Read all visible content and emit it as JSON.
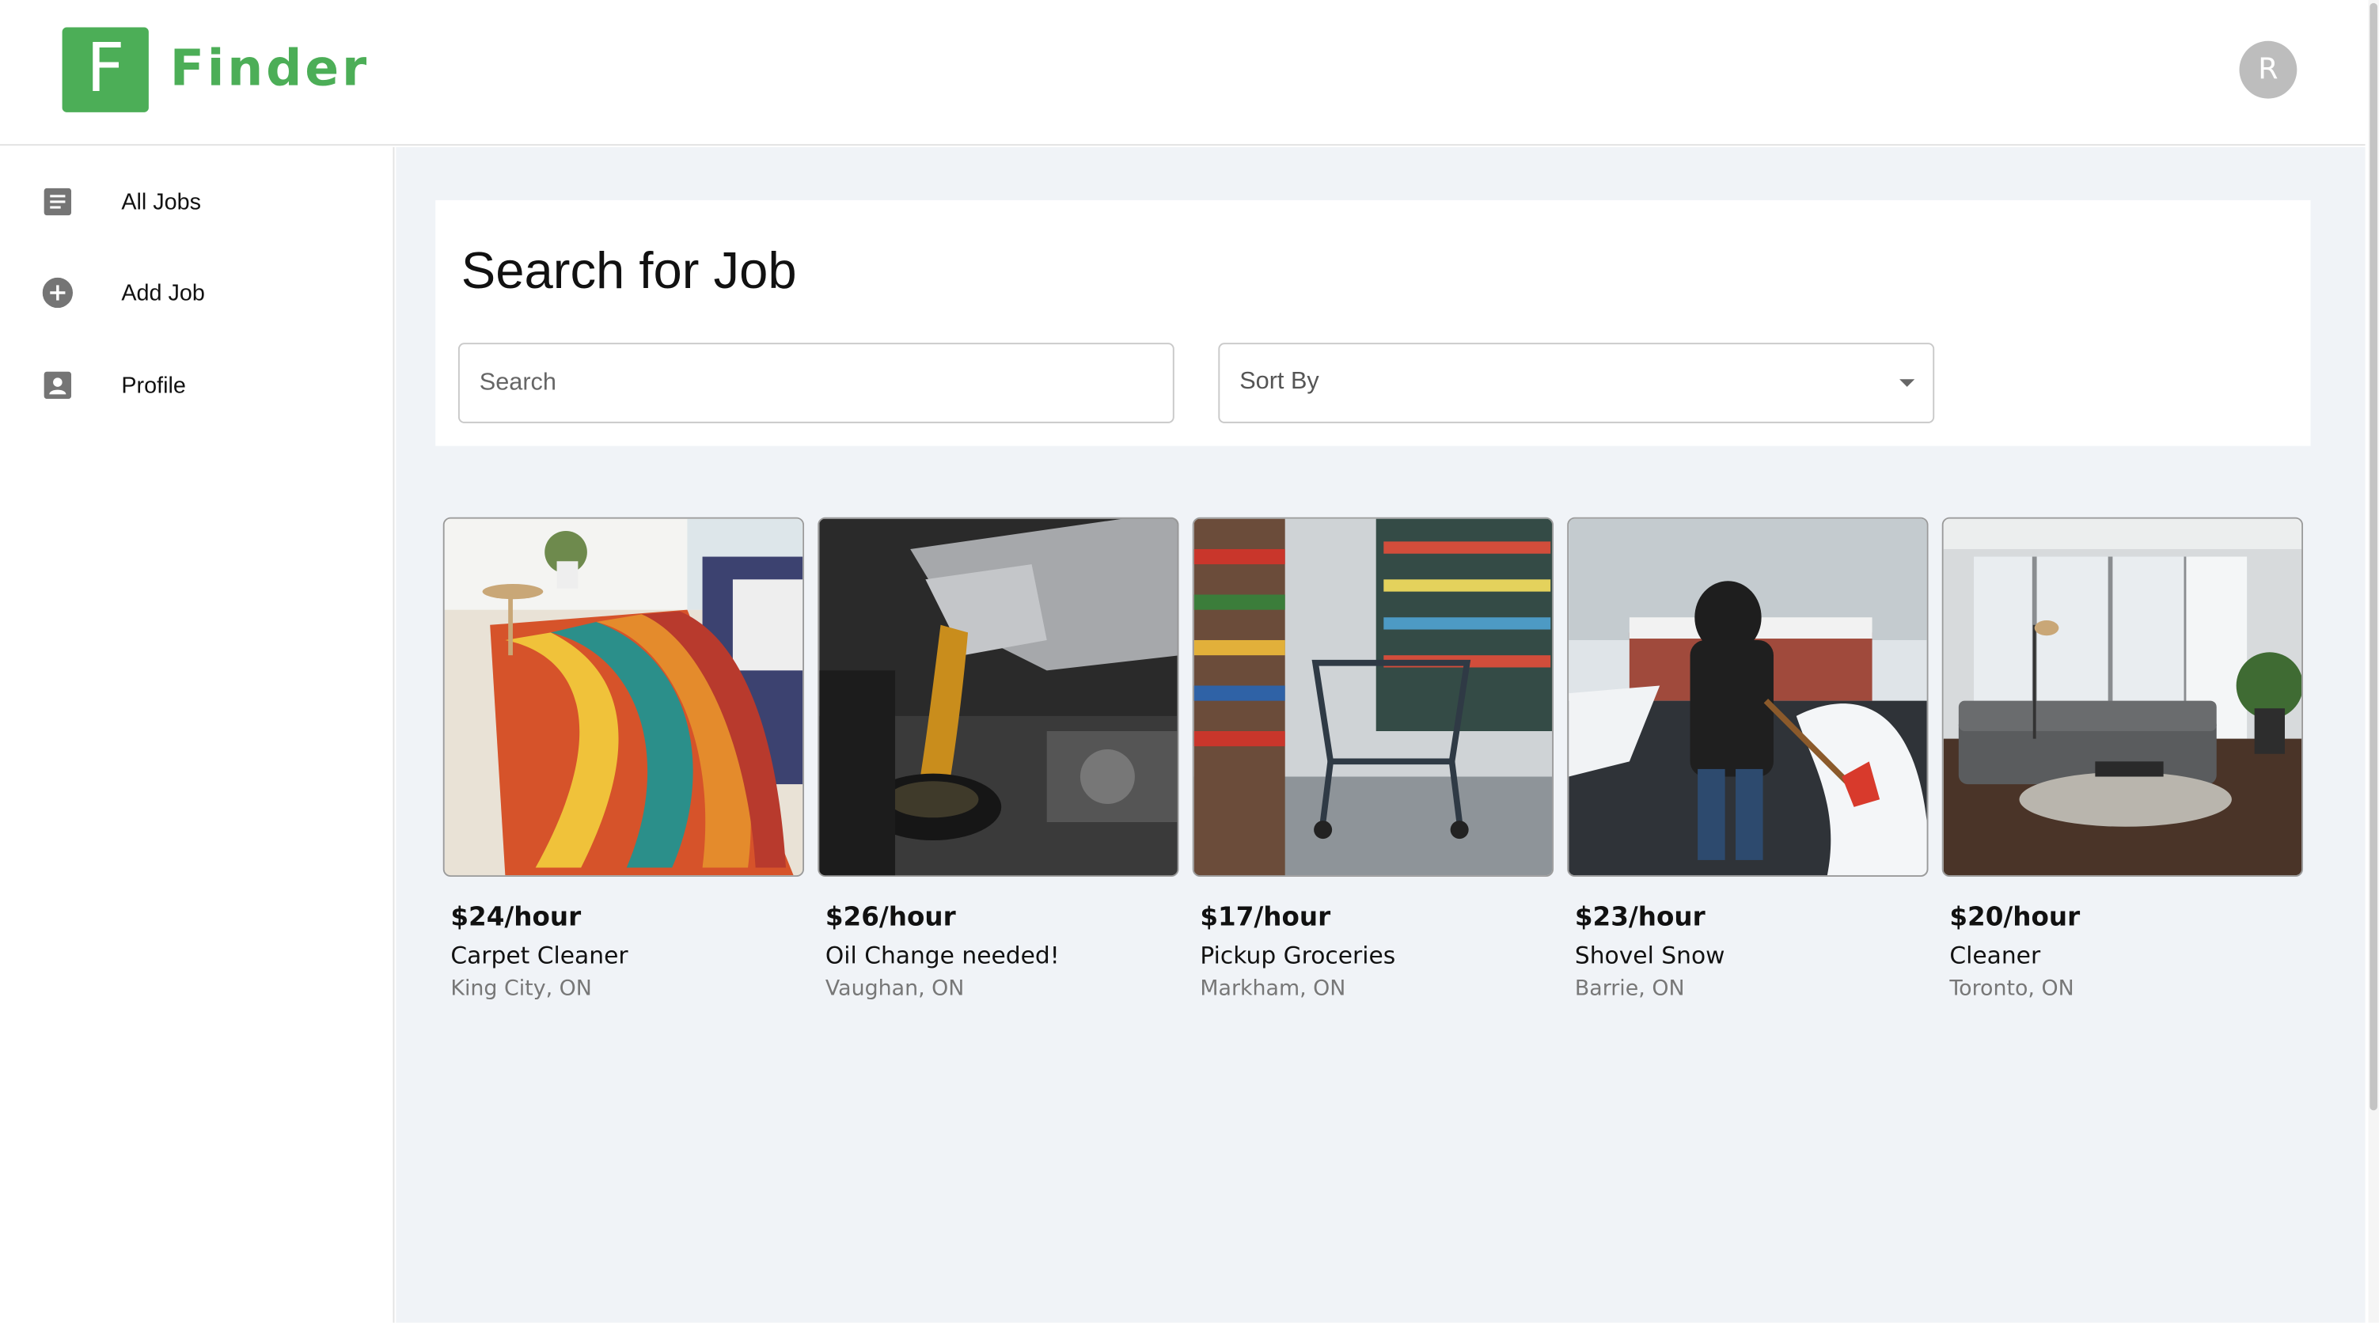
{
  "header": {
    "logo_letter": "F",
    "app_name": "Finder",
    "avatar_initial": "R"
  },
  "sidebar": {
    "items": [
      {
        "label": "All Jobs",
        "icon": "list-doc-icon"
      },
      {
        "label": "Add Job",
        "icon": "add-circle-icon"
      },
      {
        "label": "Profile",
        "icon": "person-box-icon"
      }
    ]
  },
  "search": {
    "title": "Search for Job",
    "search_placeholder": "Search",
    "sort_label": "Sort By"
  },
  "jobs": [
    {
      "price": "$24/hour",
      "title": "Carpet Cleaner",
      "location": "King City, ON",
      "image": "colorful-rug-photo"
    },
    {
      "price": "$26/hour",
      "title": "Oil Change needed!",
      "location": "Vaughan, ON",
      "image": "oil-pour-engine-photo"
    },
    {
      "price": "$17/hour",
      "title": "Pickup Groceries",
      "location": "Markham, ON",
      "image": "grocery-cart-aisle-photo"
    },
    {
      "price": "$23/hour",
      "title": "Shovel Snow",
      "location": "Barrie, ON",
      "image": "person-shoveling-snow-photo"
    },
    {
      "price": "$20/hour",
      "title": "Cleaner",
      "location": "Toronto, ON",
      "image": "living-room-sofa-photo"
    }
  ],
  "colors": {
    "brand": "#4cae57",
    "background": "#f0f3f7",
    "avatar": "#bdbdbd"
  }
}
